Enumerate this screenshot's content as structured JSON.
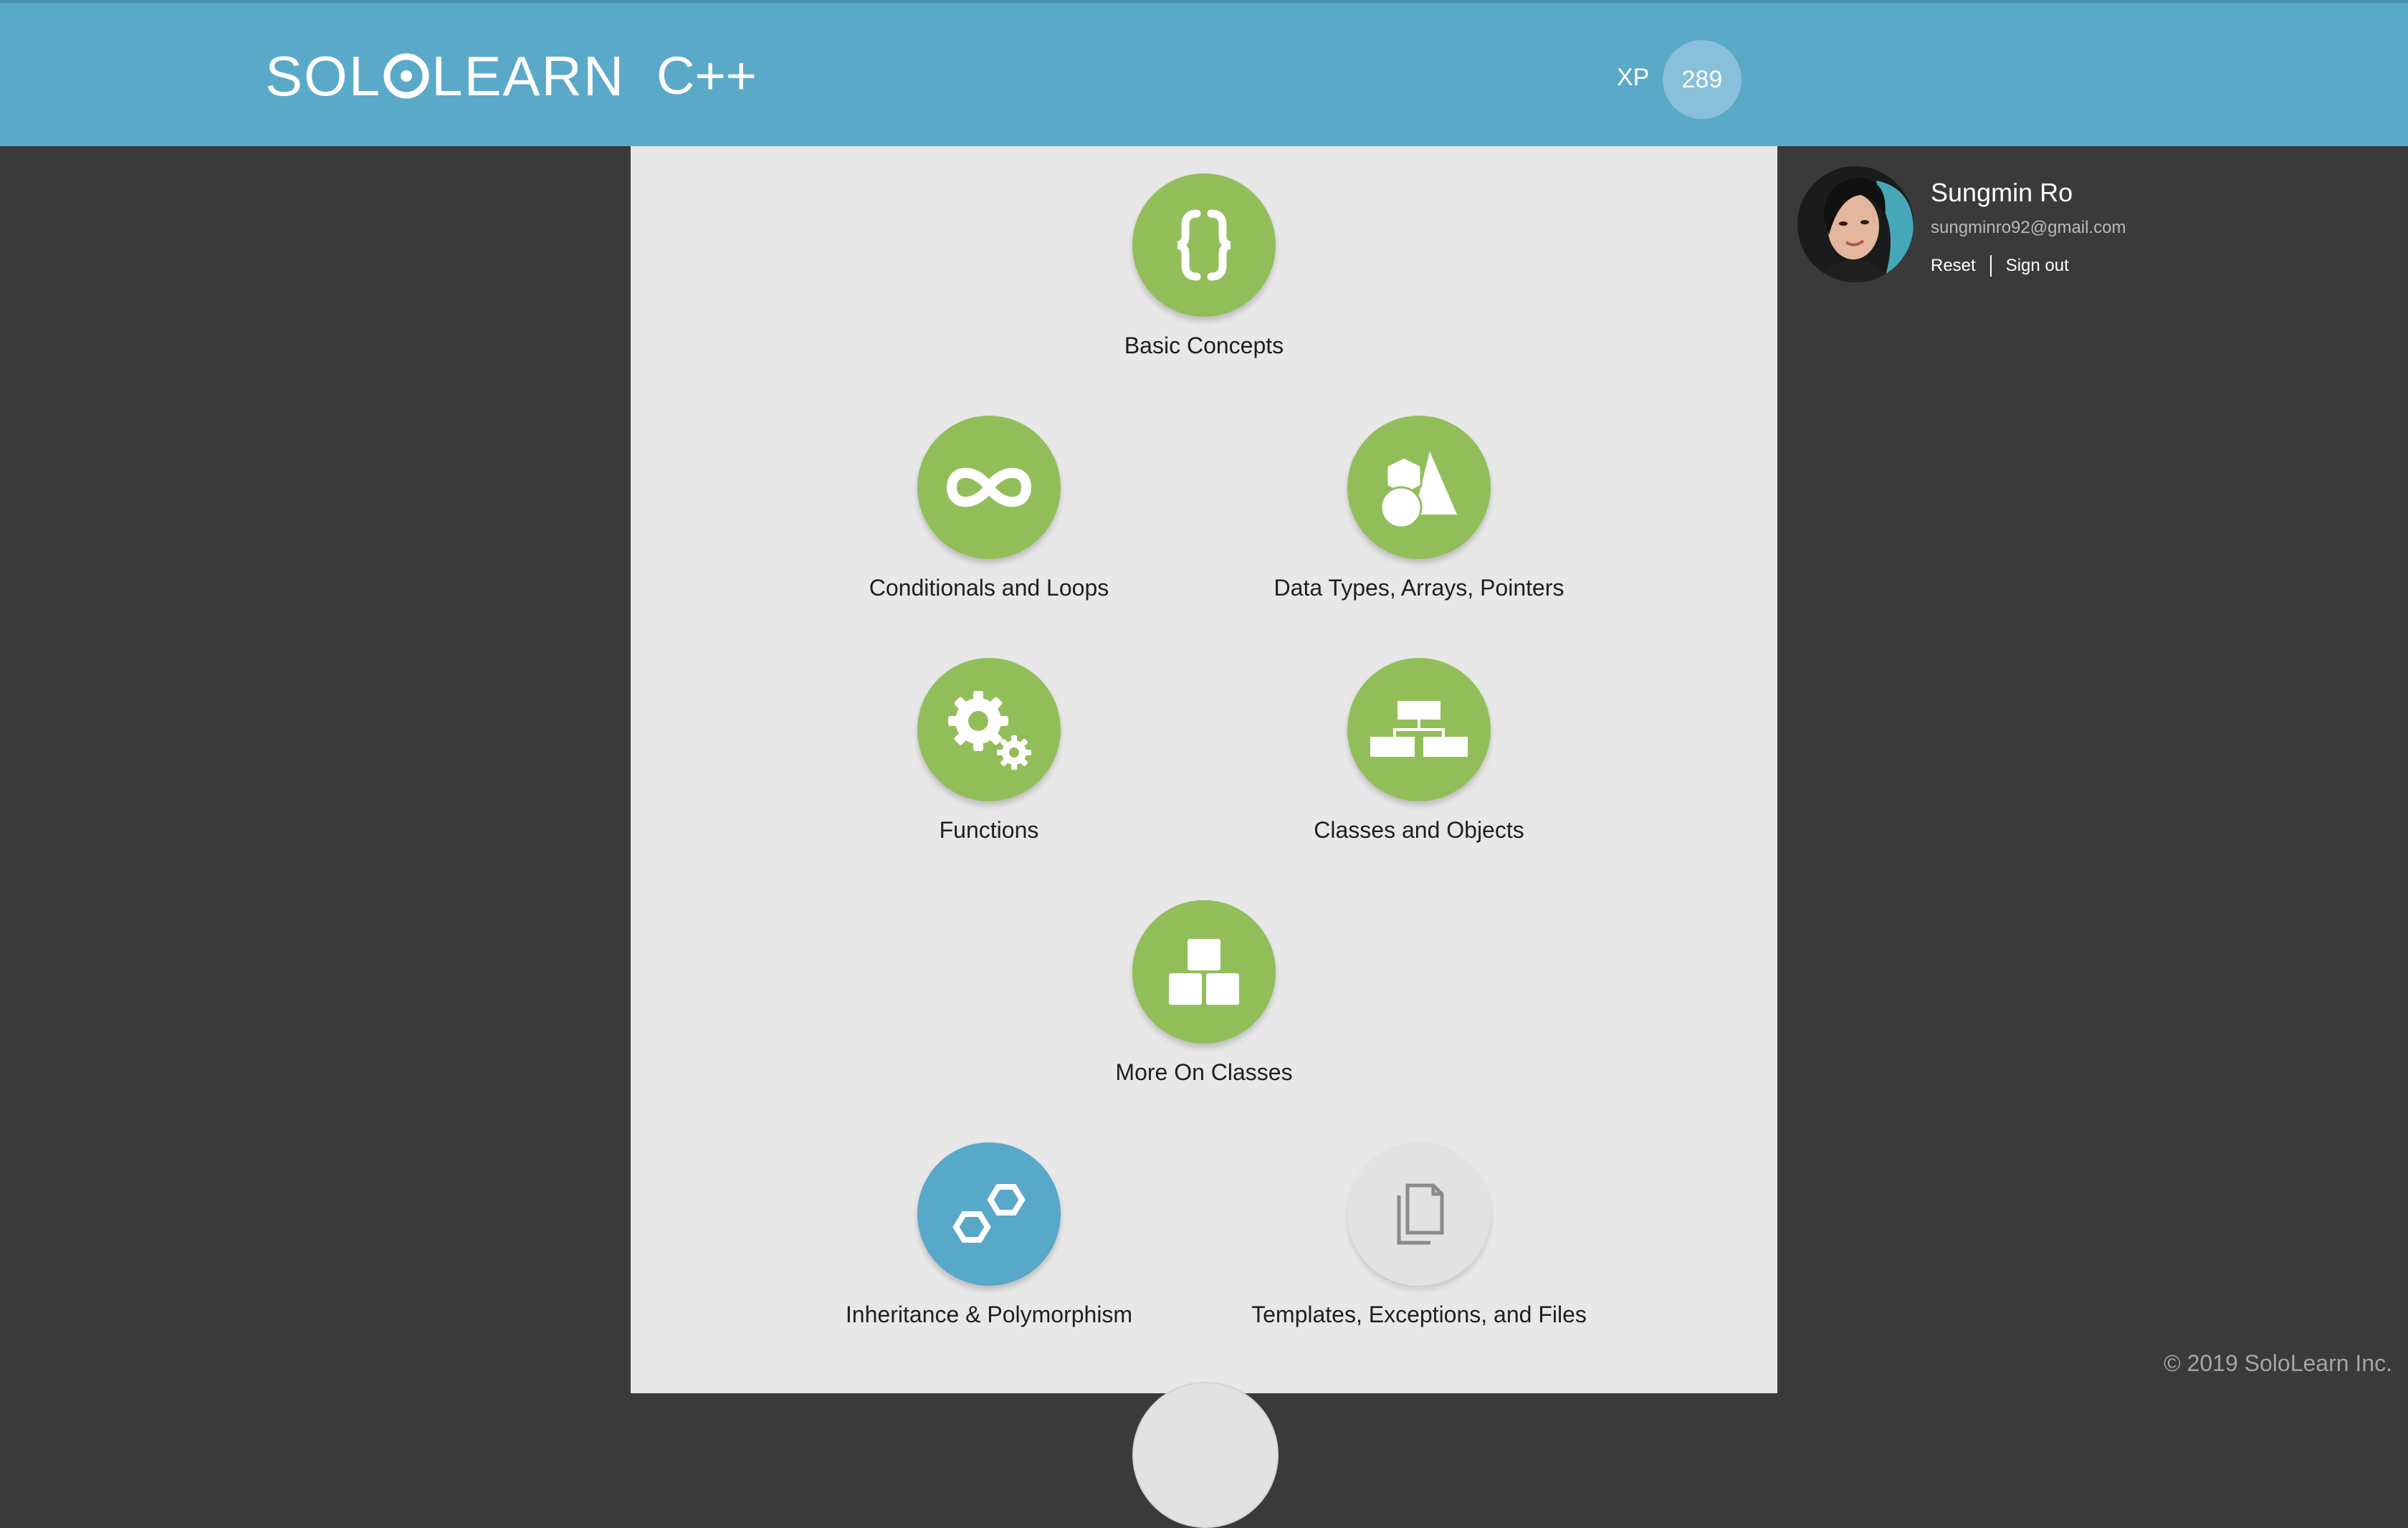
{
  "header": {
    "logo_left": "SOL",
    "logo_right": "LEARN",
    "course_title": "C++",
    "xp_label": "XP",
    "xp_value": "289"
  },
  "lessons": [
    {
      "label": "Basic Concepts",
      "icon": "curly-braces-icon",
      "state": "completed"
    },
    {
      "label": "Conditionals and Loops",
      "icon": "infinity-icon",
      "state": "completed"
    },
    {
      "label": "Data Types, Arrays, Pointers",
      "icon": "shapes-icon",
      "state": "completed"
    },
    {
      "label": "Functions",
      "icon": "gears-icon",
      "state": "completed"
    },
    {
      "label": "Classes and Objects",
      "icon": "hierarchy-icon",
      "state": "completed"
    },
    {
      "label": "More On Classes",
      "icon": "blocks-icon",
      "state": "completed"
    },
    {
      "label": "Inheritance & Polymorphism",
      "icon": "hexagons-icon",
      "state": "active"
    },
    {
      "label": "Templates, Exceptions, and Files",
      "icon": "files-icon",
      "state": "locked"
    }
  ],
  "profile": {
    "name": "Sungmin Ro",
    "email": "sungminro92@gmail.com",
    "reset_label": "Reset",
    "signout_label": "Sign out"
  },
  "footer": {
    "copyright": "© 2019 SoloLearn Inc."
  },
  "colors": {
    "header": "#5aa9c9",
    "completed": "#92be5a",
    "active": "#57a8c9",
    "locked": "#e2e2e2",
    "background": "#3a3a3a",
    "panel": "#e8e8e8"
  }
}
